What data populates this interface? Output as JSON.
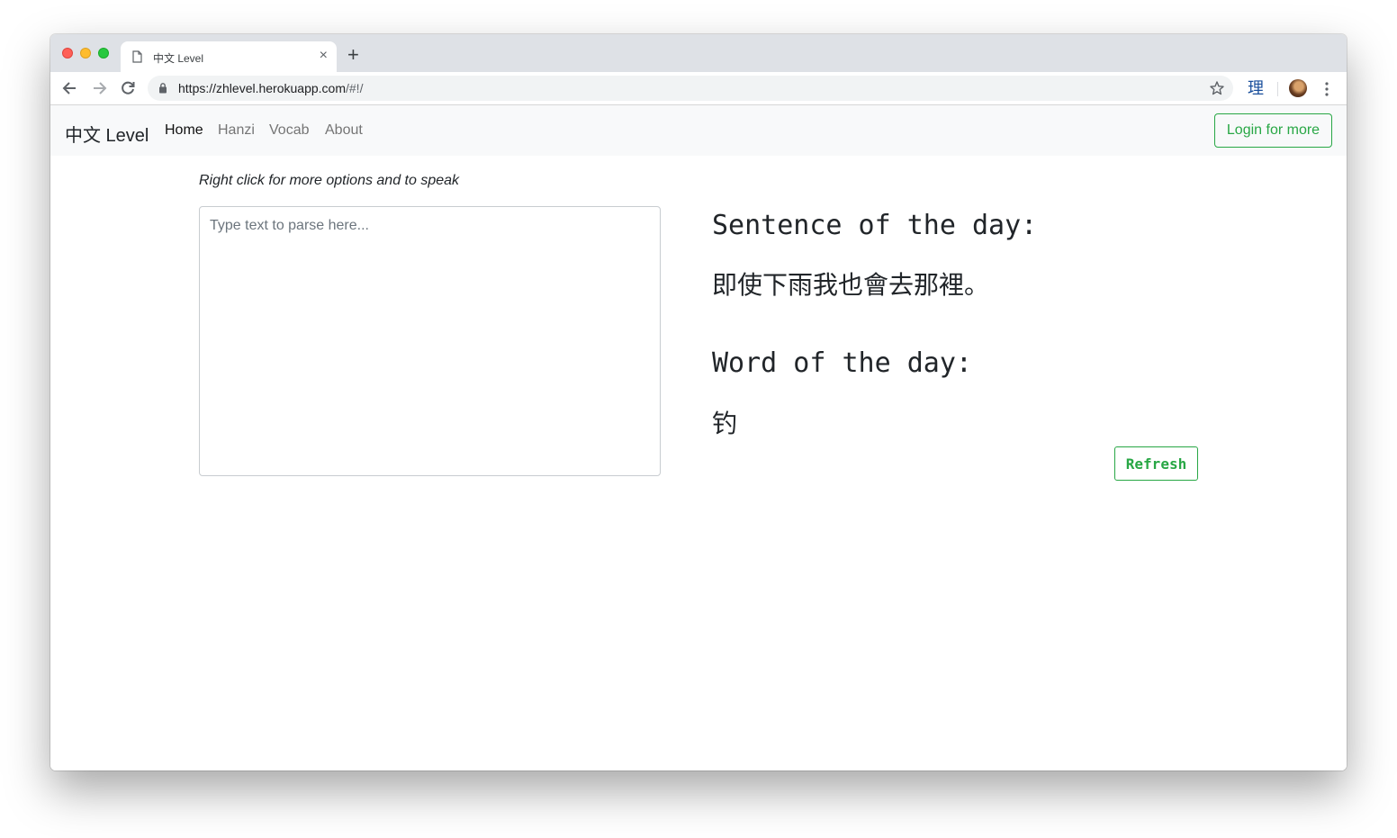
{
  "browser": {
    "tab_title": "中文 Level",
    "new_tab_symbol": "+",
    "tab_close_symbol": "×",
    "url_host": "https://zhlevel.herokuapp.com",
    "url_path": "/#!/",
    "extension_label": "理"
  },
  "navbar": {
    "brand": "中文 Level",
    "links": [
      {
        "label": "Home",
        "active": true
      },
      {
        "label": "Hanzi",
        "active": false
      },
      {
        "label": "Vocab",
        "active": false
      },
      {
        "label": "About",
        "active": false
      }
    ],
    "login_label": "Login for more"
  },
  "main": {
    "hint": "Right click for more options and to speak",
    "textarea_placeholder": "Type text to parse here...",
    "sentence_heading": "Sentence of the day:",
    "sentence": "即使下雨我也會去那裡。",
    "word_heading": "Word of the day:",
    "word": "钓",
    "refresh_label": "Refresh"
  },
  "colors": {
    "accent_green": "#28a745",
    "navbar_bg": "#f8f9fa",
    "tabstrip_bg": "#dee1e6"
  }
}
